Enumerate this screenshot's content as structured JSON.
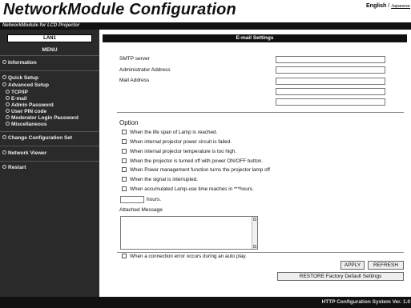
{
  "header": {
    "title": "NetworkModule Configuration",
    "subtitle": "NetworkModule for LCD Projector",
    "lang_en": "English",
    "lang_sep": " / ",
    "lang_jp": "Japanese"
  },
  "sidebar": {
    "lan_tab": "LAN1",
    "menu_label": "MENU",
    "items": [
      {
        "label": "Information"
      },
      {
        "label": "Quick Setup"
      },
      {
        "label": "Advanced Setup"
      },
      {
        "label": "TCP/IP"
      },
      {
        "label": "E-mail"
      },
      {
        "label": "Admin Password"
      },
      {
        "label": "User PIN code"
      },
      {
        "label": "Moderator Login Password"
      },
      {
        "label": "Miscellaneous"
      },
      {
        "label": "Change Configuration Set"
      },
      {
        "label": "Network Viewer"
      },
      {
        "label": "Restart"
      }
    ]
  },
  "main": {
    "section_title": "E-mail Settings",
    "fields": {
      "smtp": {
        "label": "SMTP server",
        "value": ""
      },
      "admin": {
        "label": "Administrator Address",
        "value": ""
      },
      "mail": {
        "label": "Mail Address",
        "value": ""
      }
    },
    "option_title": "Option",
    "options": [
      {
        "label": "When the life span of Lamp is reached.",
        "checked": false
      },
      {
        "label": "When internal projector power circuit is failed.",
        "checked": false
      },
      {
        "label": "When internal projector temperature is too high.",
        "checked": false
      },
      {
        "label": "When the projector is turned off with power ON/OFF button.",
        "checked": false
      },
      {
        "label": "When Power management function turns the projector lamp off",
        "checked": false
      },
      {
        "label": "When the signal is interrupted.",
        "checked": false
      },
      {
        "label": "When accumulated Lamp-use time reaches in ***hours.",
        "checked": false
      }
    ],
    "hours_value": "",
    "hours_label": "hours.",
    "attached_label": "Attached Message",
    "attached_value": "",
    "conn_error": {
      "label": "When a connection error occurs during an auto play.",
      "checked": false
    },
    "buttons": {
      "apply": "APPLY",
      "refresh": "REFRESH",
      "restore": "RESTORE Factory Default Settings"
    }
  },
  "footer": {
    "text": "HTTP Configuration System Ver. 1.0"
  },
  "colors": {
    "header_bar": "#111111",
    "sidebar_bg": "#2a2a2a",
    "content_bg": "#ffffff",
    "footer_bg": "#111111"
  }
}
